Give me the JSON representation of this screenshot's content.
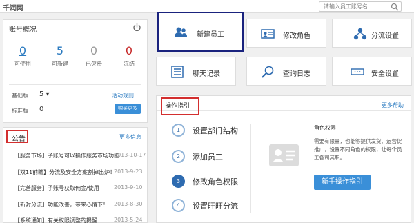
{
  "header": {
    "logo_text": "千润网",
    "search_placeholder": "请输入员工账号名"
  },
  "account": {
    "title": "账号概况",
    "stats": [
      {
        "value": "0",
        "label": "可使用"
      },
      {
        "value": "5",
        "label": "可新建"
      },
      {
        "value": "0",
        "label": "已欠费"
      },
      {
        "value": "0",
        "label": "冻结"
      }
    ],
    "basic_label": "基础版",
    "basic_value": "5 ▾",
    "activity_link": "活动规则",
    "standard_label": "标准版",
    "standard_value": "0",
    "buy_button": "购买更多"
  },
  "notice": {
    "title": "公告",
    "more": "更多信息",
    "items": [
      {
        "text": "【服务市场】子账号可以操作服务市场功能",
        "date": "2013-10-17"
      },
      {
        "text": "【双11前瞻】分流及安全方案割掉出炉！",
        "date": "2013-9-23"
      },
      {
        "text": "【完善服务】子账号获取佣金/使用",
        "date": "2013-9-10"
      },
      {
        "text": "【新封分流】功能改善，带来心情下！",
        "date": "2013-8-30"
      },
      {
        "text": "【系统通知】有关权限调整的提醒",
        "date": "2013-5-24"
      }
    ]
  },
  "tiles": [
    {
      "label": "新建员工",
      "icon": "users-icon"
    },
    {
      "label": "修改角色",
      "icon": "id-card-icon"
    },
    {
      "label": "分流设置",
      "icon": "network-icon"
    },
    {
      "label": "聊天记录",
      "icon": "chat-record-icon"
    },
    {
      "label": "查询日志",
      "icon": "search-log-icon"
    },
    {
      "label": "安全设置",
      "icon": "password-icon"
    }
  ],
  "guide": {
    "title": "操作指引",
    "more": "更多帮助",
    "steps": [
      {
        "num": "1",
        "label": "设置部门结构"
      },
      {
        "num": "2",
        "label": "添加员工"
      },
      {
        "num": "3",
        "label": "修改角色权限"
      },
      {
        "num": "4",
        "label": "设置旺旺分流"
      }
    ],
    "heading": "角色权限",
    "desc": "需要有限量，也能够提供发货、运营促推广，设置不同角色的权限，让每个员工各司其职。",
    "button": "新手操作指引"
  },
  "colors": {
    "accent": "#3a8fd8",
    "highlight_red": "#d32f2f",
    "highlight_navy": "#1a237e"
  }
}
